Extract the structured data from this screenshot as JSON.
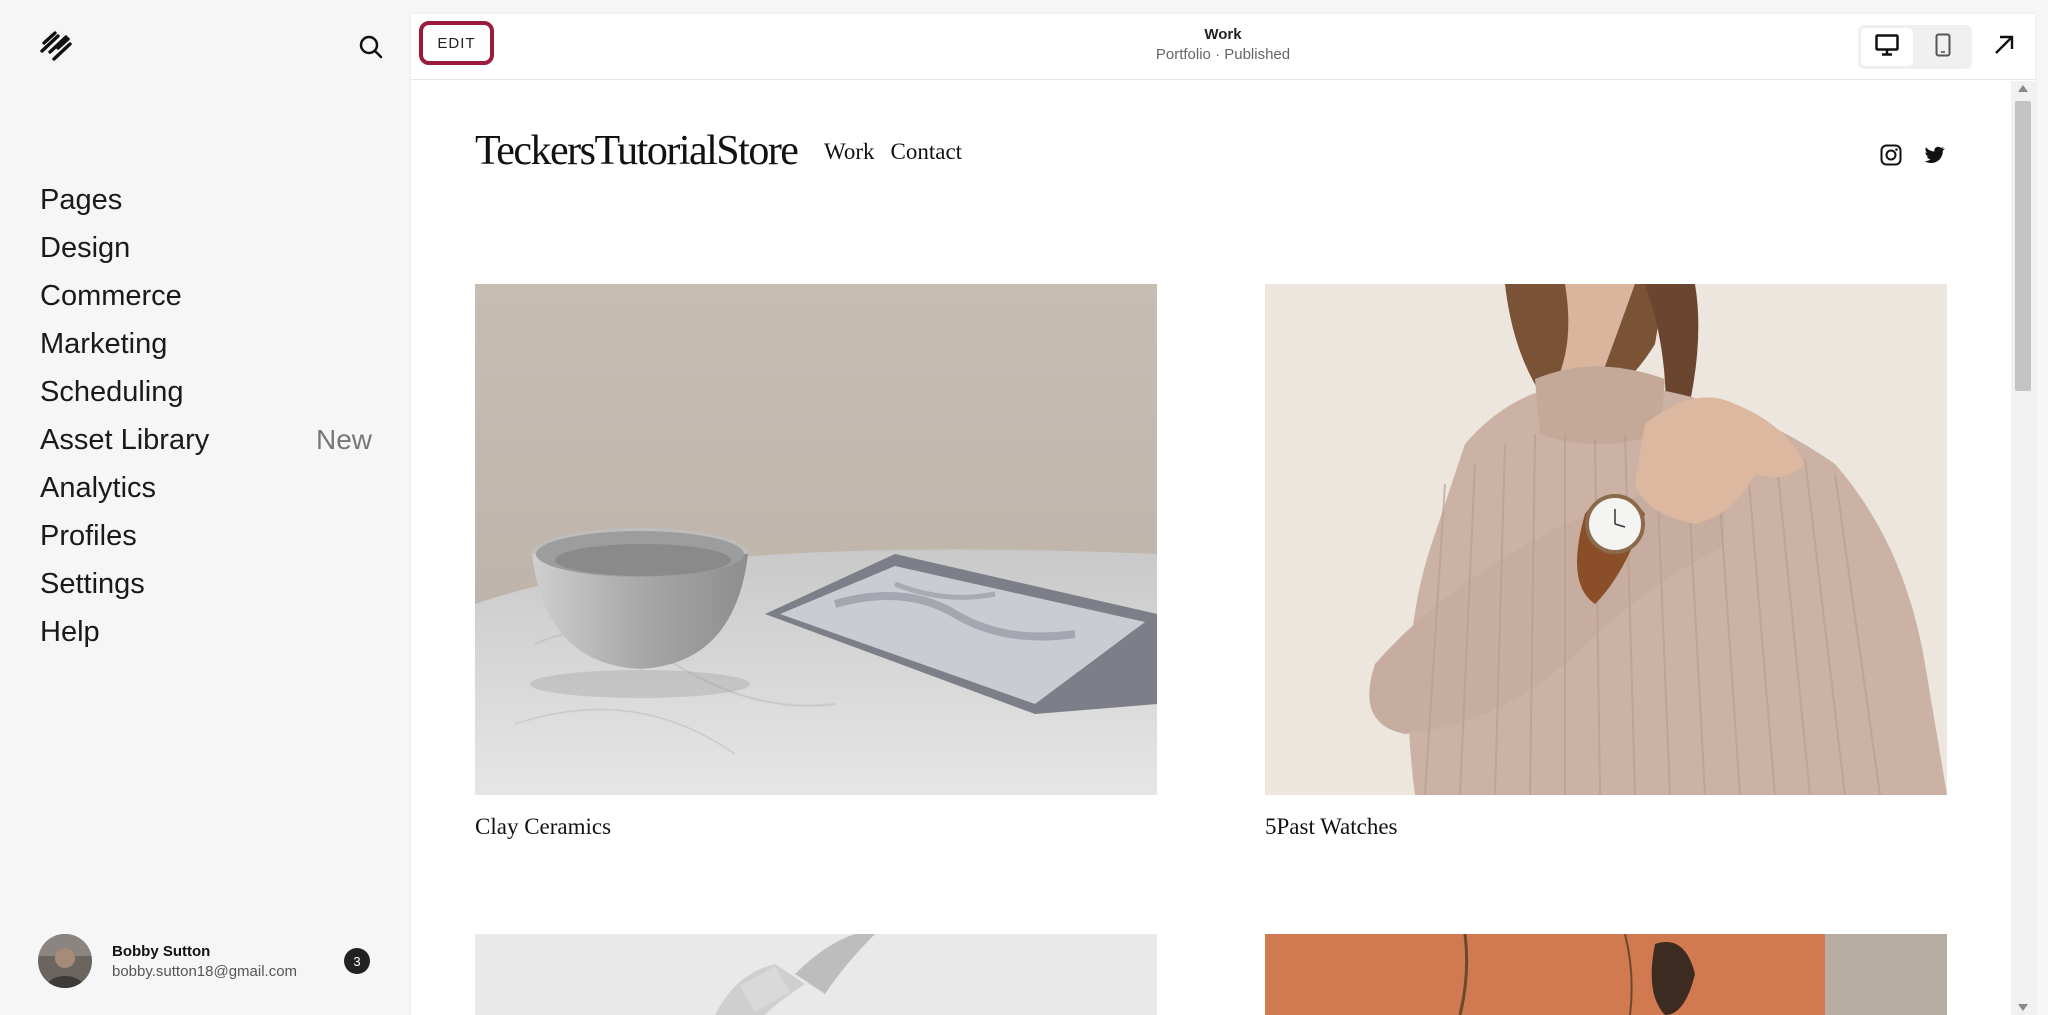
{
  "sidebar": {
    "items": [
      {
        "label": "Pages"
      },
      {
        "label": "Design"
      },
      {
        "label": "Commerce"
      },
      {
        "label": "Marketing"
      },
      {
        "label": "Scheduling"
      },
      {
        "label": "Asset Library",
        "badge": "New"
      },
      {
        "label": "Analytics"
      },
      {
        "label": "Profiles"
      },
      {
        "label": "Settings"
      },
      {
        "label": "Help"
      }
    ],
    "user": {
      "name": "Bobby Sutton",
      "email": "bobby.sutton18@gmail.com",
      "notifications": "3"
    }
  },
  "topbar": {
    "edit_label": "EDIT",
    "page_title": "Work",
    "page_subtitle": "Portfolio · Published"
  },
  "site": {
    "brand": "TeckersTutorialStore",
    "nav": [
      "Work",
      "Contact"
    ],
    "projects": [
      {
        "title": "Clay Ceramics"
      },
      {
        "title": "5Past Watches"
      }
    ]
  },
  "colors": {
    "edit_highlight": "#9b1b3a",
    "sidebar_bg": "#f6f6f6"
  }
}
